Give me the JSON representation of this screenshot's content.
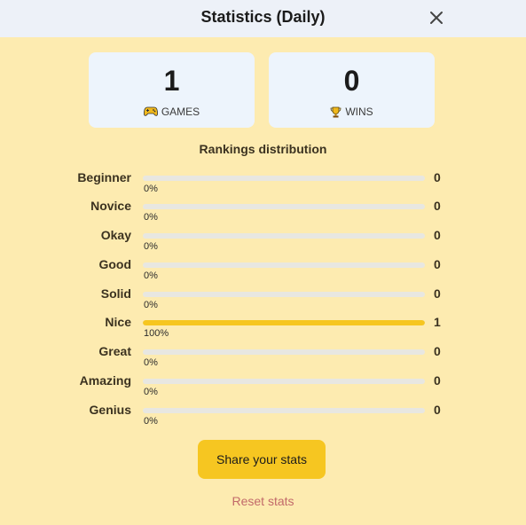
{
  "header": {
    "title": "Statistics (Daily)"
  },
  "stats": {
    "games": {
      "value": "1",
      "label": "GAMES"
    },
    "wins": {
      "value": "0",
      "label": "WINS"
    }
  },
  "distribution": {
    "title": "Rankings distribution",
    "rows": [
      {
        "name": "Beginner",
        "count": "0",
        "percent_label": "0%",
        "fraction": 0
      },
      {
        "name": "Novice",
        "count": "0",
        "percent_label": "0%",
        "fraction": 0
      },
      {
        "name": "Okay",
        "count": "0",
        "percent_label": "0%",
        "fraction": 0
      },
      {
        "name": "Good",
        "count": "0",
        "percent_label": "0%",
        "fraction": 0
      },
      {
        "name": "Solid",
        "count": "0",
        "percent_label": "0%",
        "fraction": 0
      },
      {
        "name": "Nice",
        "count": "1",
        "percent_label": "100%",
        "fraction": 1
      },
      {
        "name": "Great",
        "count": "0",
        "percent_label": "0%",
        "fraction": 0
      },
      {
        "name": "Amazing",
        "count": "0",
        "percent_label": "0%",
        "fraction": 0
      },
      {
        "name": "Genius",
        "count": "0",
        "percent_label": "0%",
        "fraction": 0
      }
    ]
  },
  "actions": {
    "share_label": "Share your stats",
    "reset_label": "Reset stats"
  },
  "colors": {
    "accent": "#f6c621",
    "background": "#fdebb0",
    "header": "#edf1f8",
    "reset": "#c26a6a"
  },
  "icons": {
    "close": "close-icon",
    "games": "game-controller-icon",
    "wins": "trophy-icon"
  }
}
